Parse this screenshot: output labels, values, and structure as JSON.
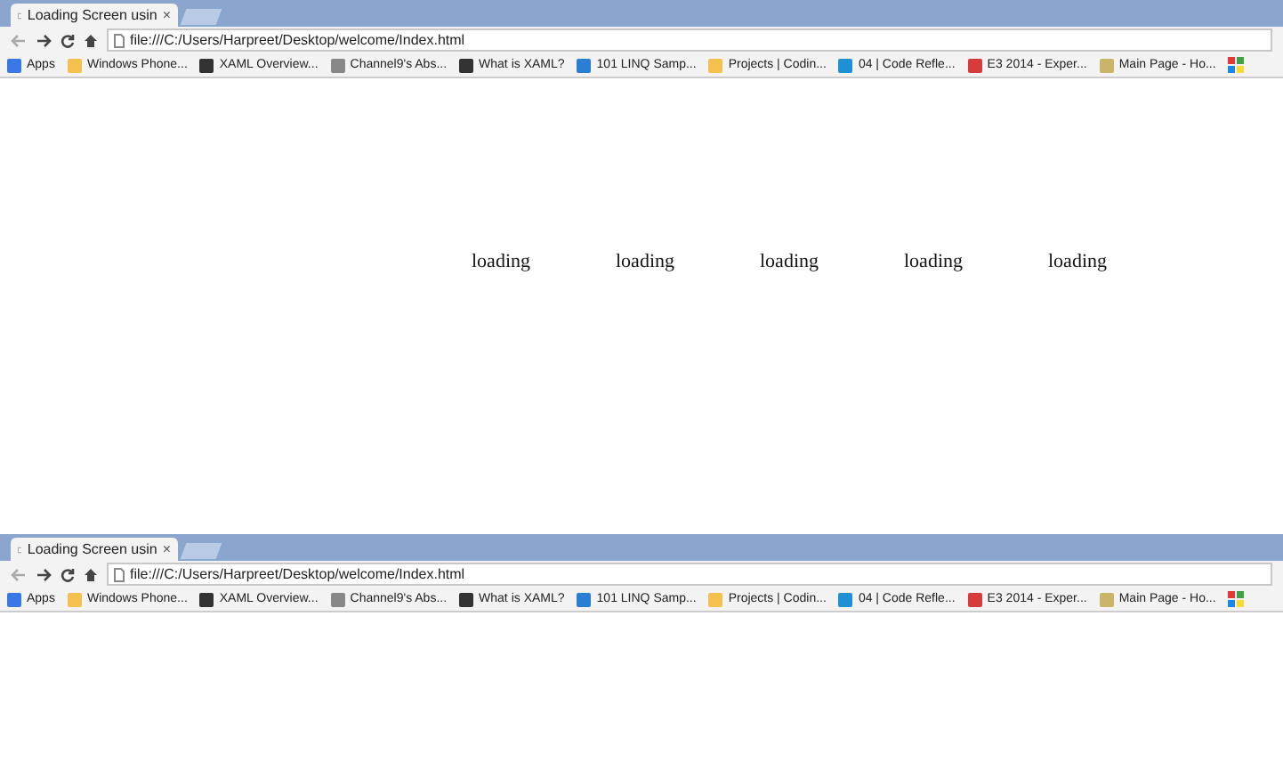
{
  "windows": [
    {
      "tab": {
        "title": "Loading Screen usin",
        "close": "×"
      },
      "url": "file:///C:/Users/Harpreet/Desktop/welcome/Index.html",
      "bookmarks": [
        {
          "label": "Apps",
          "color": "#3b78e7"
        },
        {
          "label": "Windows Phone...",
          "color": "#f2c14e"
        },
        {
          "label": "XAML Overview...",
          "color": "#333333"
        },
        {
          "label": "Channel9's Abs...",
          "color": "#888888"
        },
        {
          "label": "What is XAML?",
          "color": "#333333"
        },
        {
          "label": "101 LINQ Samp...",
          "color": "#2a7fd4"
        },
        {
          "label": "Projects | Codin...",
          "color": "#f2c14e"
        },
        {
          "label": "04 | Code Refle...",
          "color": "#1e90d6"
        },
        {
          "label": "E3 2014 - Exper...",
          "color": "#d63a3a"
        },
        {
          "label": "Main Page - Ho...",
          "color": "#c9b46a"
        }
      ],
      "content": [
        "loading",
        "loading",
        "loading",
        "loading",
        "loading"
      ]
    },
    {
      "tab": {
        "title": "Loading Screen usin",
        "close": "×"
      },
      "url": "file:///C:/Users/Harpreet/Desktop/welcome/Index.html",
      "bookmarks": [
        {
          "label": "Apps",
          "color": "#3b78e7"
        },
        {
          "label": "Windows Phone...",
          "color": "#f2c14e"
        },
        {
          "label": "XAML Overview...",
          "color": "#333333"
        },
        {
          "label": "Channel9's Abs...",
          "color": "#888888"
        },
        {
          "label": "What is XAML?",
          "color": "#333333"
        },
        {
          "label": "101 LINQ Samp...",
          "color": "#2a7fd4"
        },
        {
          "label": "Projects | Codin...",
          "color": "#f2c14e"
        },
        {
          "label": "04 | Code Refle...",
          "color": "#1e90d6"
        },
        {
          "label": "E3 2014 - Exper...",
          "color": "#d63a3a"
        },
        {
          "label": "Main Page - Ho...",
          "color": "#c9b46a"
        }
      ]
    }
  ]
}
